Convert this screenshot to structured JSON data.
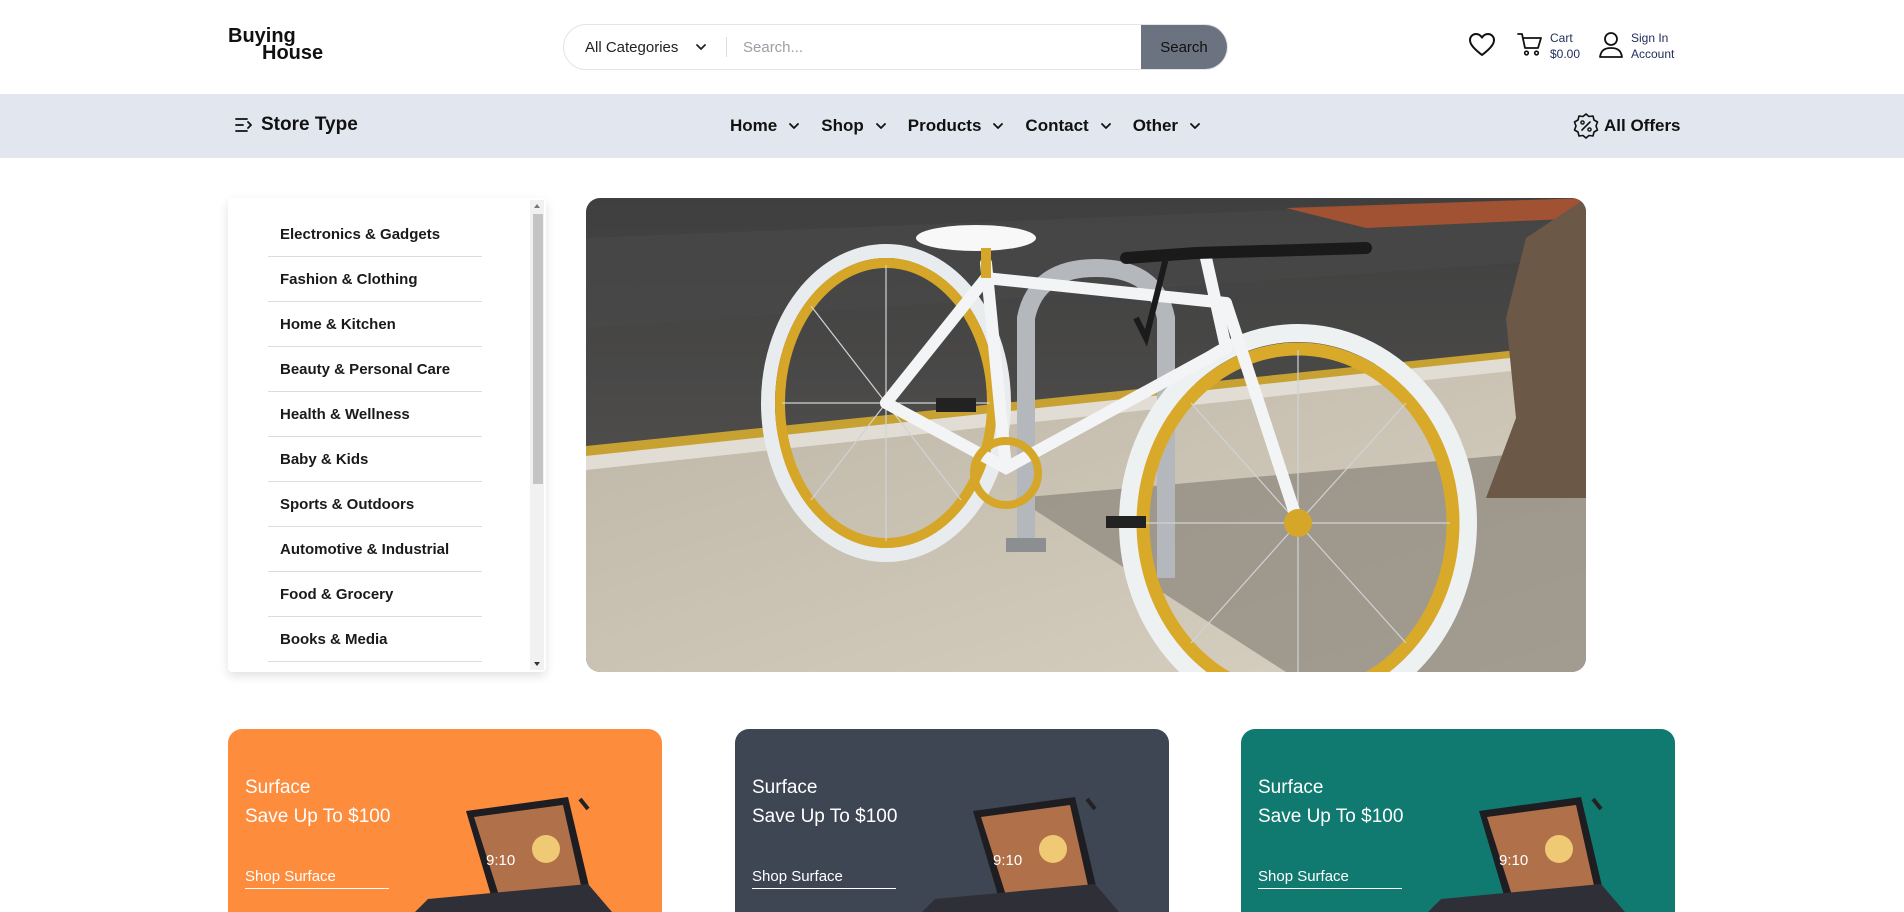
{
  "logo": {
    "line1": "Buying",
    "line2": "House"
  },
  "search": {
    "category_selected": "All Categories",
    "placeholder": "Search...",
    "button_label": "Search"
  },
  "cart": {
    "label": "Cart",
    "amount": "$0.00"
  },
  "account": {
    "line1": "Sign In",
    "line2": "Account"
  },
  "nav": {
    "store_type": "Store Type",
    "menu": [
      {
        "label": "Home"
      },
      {
        "label": "Shop"
      },
      {
        "label": "Products"
      },
      {
        "label": "Contact"
      },
      {
        "label": "Other"
      }
    ],
    "offers": "All Offers"
  },
  "sidebar": {
    "categories": [
      "Electronics & Gadgets",
      "Fashion & Clothing",
      "Home & Kitchen",
      "Beauty & Personal Care",
      "Health & Wellness",
      "Baby & Kids",
      "Sports & Outdoors",
      "Automotive & Industrial",
      "Food & Grocery",
      "Books & Media"
    ]
  },
  "promos": [
    {
      "line1": "Surface",
      "line2": "Save Up To $100",
      "link": "Shop Surface",
      "color": "#fd8c3d"
    },
    {
      "line1": "Surface",
      "line2": "Save Up To $100",
      "link": "Shop Surface",
      "color": "#3e4553"
    },
    {
      "line1": "Surface",
      "line2": "Save Up To $100",
      "link": "Shop Surface",
      "color": "#117a70"
    }
  ],
  "promo_screen_time": "9:10",
  "colors": {
    "nav_bg": "#e2e7ef",
    "search_button": "#6b7280",
    "account_text": "#1f2b5a"
  }
}
